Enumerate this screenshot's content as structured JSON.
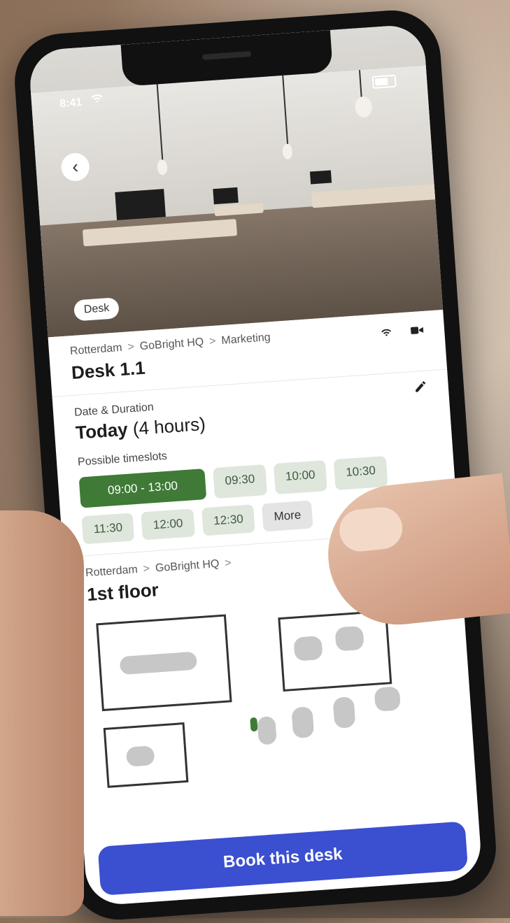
{
  "status": {
    "time": "8:41",
    "wifi_icon": "wifi-icon",
    "battery_icon": "battery-icon"
  },
  "photo": {
    "tag_label": "Desk",
    "back_icon": "chevron-left-icon"
  },
  "desk": {
    "breadcrumb": [
      "Rotterdam",
      "GoBright HQ",
      "Marketing"
    ],
    "separator": ">",
    "title": "Desk 1.1",
    "amenity_icons": [
      "wifi-icon",
      "video-icon"
    ]
  },
  "booking": {
    "edit_icon": "pencil-icon",
    "date_label": "Date & Duration",
    "date_value_strong": "Today",
    "date_value_rest": " (4 hours)",
    "timeslots_label": "Possible timeslots",
    "timeslots": [
      {
        "label": "09:00 - 13:00",
        "selected": true
      },
      {
        "label": "09:30",
        "selected": false
      },
      {
        "label": "10:00",
        "selected": false
      },
      {
        "label": "10:30",
        "selected": false
      },
      {
        "label": "11:30",
        "selected": false
      },
      {
        "label": "12:00",
        "selected": false
      },
      {
        "label": "12:30",
        "selected": false
      },
      {
        "label": "More",
        "selected": false
      }
    ]
  },
  "floor": {
    "breadcrumb": [
      "Rotterdam",
      "GoBright HQ"
    ],
    "separator": ">",
    "title": "1st floor"
  },
  "cta": {
    "book_label": "Book this desk"
  },
  "colors": {
    "primary": "#3b4fd1",
    "selected_slot": "#3f7a37",
    "slot_bg": "#dfe6dc"
  }
}
